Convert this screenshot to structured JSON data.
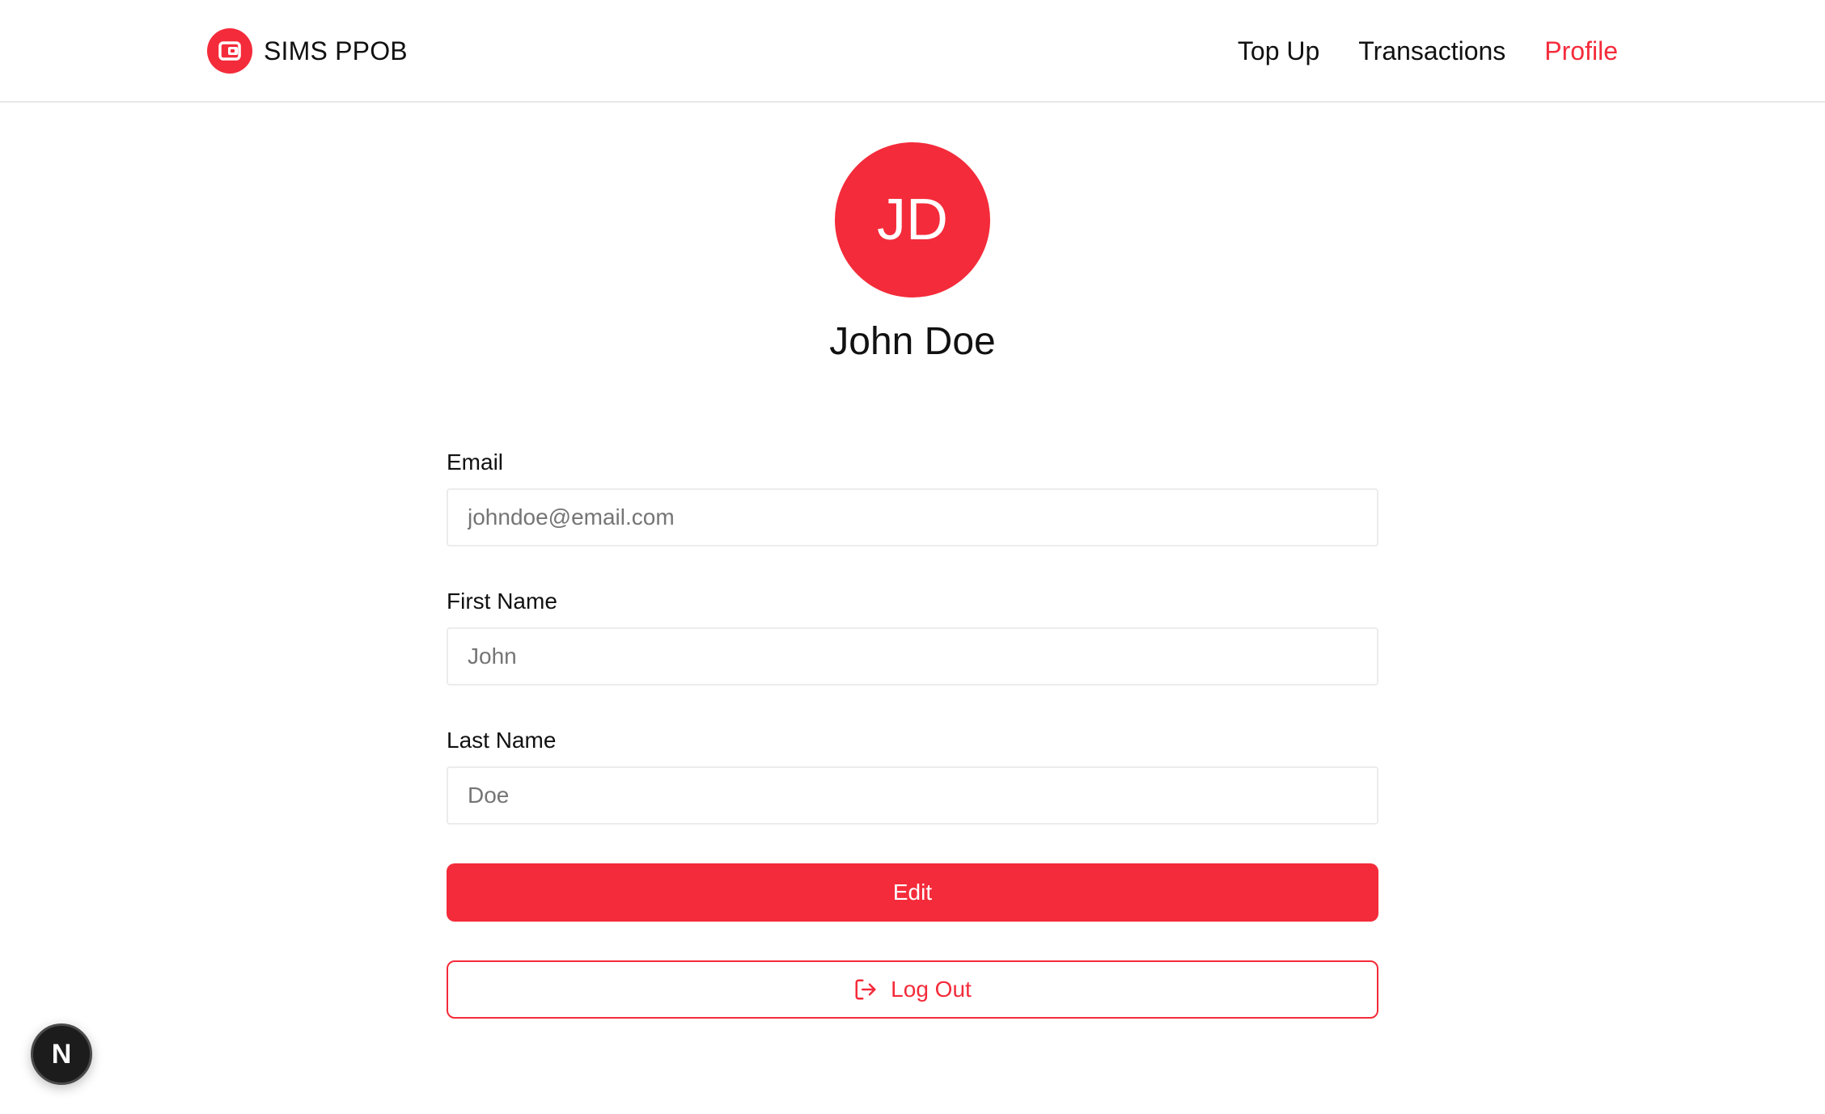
{
  "brand": {
    "name": "SIMS PPOB",
    "logo_icon": "wallet-icon"
  },
  "nav": {
    "items": [
      {
        "label": "Top Up",
        "active": false
      },
      {
        "label": "Transactions",
        "active": false
      },
      {
        "label": "Profile",
        "active": true
      }
    ]
  },
  "profile": {
    "initials": "JD",
    "display_name": "John Doe"
  },
  "form": {
    "email": {
      "label": "Email",
      "placeholder": "johndoe@email.com",
      "value": ""
    },
    "first_name": {
      "label": "First Name",
      "placeholder": "John",
      "value": ""
    },
    "last_name": {
      "label": "Last Name",
      "placeholder": "Doe",
      "value": ""
    }
  },
  "actions": {
    "edit_label": "Edit",
    "logout_label": "Log Out",
    "logout_icon": "logout-icon"
  },
  "dev_badge": {
    "letter": "N",
    "icon": "nextjs-icon"
  },
  "colors": {
    "accent": "#f42b3a",
    "text": "#111111",
    "muted_text": "#777777",
    "border": "#ececec"
  }
}
